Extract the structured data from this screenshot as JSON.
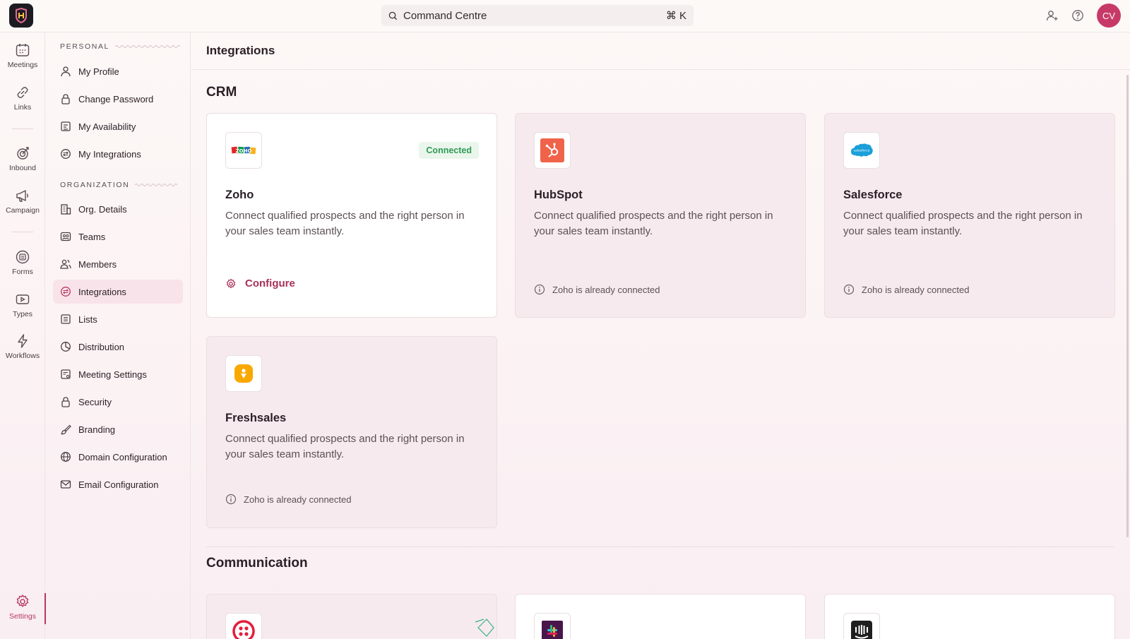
{
  "topbar": {
    "search_label": "Command Centre",
    "shortcut": "⌘ K",
    "avatar_initials": "CV",
    "accent_color": "#c73a68"
  },
  "rail": {
    "items": [
      {
        "label": "Meetings",
        "icon": "calendar-icon"
      },
      {
        "label": "Links",
        "icon": "link-icon"
      },
      {
        "label": "Inbound",
        "icon": "inbound-icon"
      },
      {
        "label": "Campaign",
        "icon": "megaphone-icon"
      },
      {
        "label": "Forms",
        "icon": "forms-icon"
      },
      {
        "label": "Types",
        "icon": "video-icon"
      },
      {
        "label": "Workflows",
        "icon": "lightning-icon"
      },
      {
        "label": "Settings",
        "icon": "gear-icon",
        "active": true
      }
    ]
  },
  "subnav": {
    "personal_heading": "PERSONAL",
    "organization_heading": "ORGANIZATION",
    "personal_items": [
      {
        "label": "My Profile",
        "icon": "user-icon"
      },
      {
        "label": "Change Password",
        "icon": "lock-icon"
      },
      {
        "label": "My Availability",
        "icon": "availability-icon"
      },
      {
        "label": "My Integrations",
        "icon": "integrations-icon"
      }
    ],
    "organization_items": [
      {
        "label": "Org. Details",
        "icon": "building-icon"
      },
      {
        "label": "Teams",
        "icon": "teams-icon"
      },
      {
        "label": "Members",
        "icon": "members-icon"
      },
      {
        "label": "Integrations",
        "icon": "integrations-icon",
        "active": true
      },
      {
        "label": "Lists",
        "icon": "list-icon"
      },
      {
        "label": "Distribution",
        "icon": "pie-icon"
      },
      {
        "label": "Meeting Settings",
        "icon": "meeting-settings-icon"
      },
      {
        "label": "Security",
        "icon": "lock-icon"
      },
      {
        "label": "Branding",
        "icon": "brush-icon"
      },
      {
        "label": "Domain Configuration",
        "icon": "globe-icon"
      },
      {
        "label": "Email Configuration",
        "icon": "mail-icon"
      }
    ]
  },
  "main": {
    "page_title": "Integrations",
    "crm_title": "CRM",
    "communication_title": "Communication",
    "crm_cards": [
      {
        "name": "Zoho",
        "description": "Connect qualified prospects and the right person in your sales team instantly.",
        "status": "Connected",
        "action": "Configure",
        "logo_text": "ZOHO"
      },
      {
        "name": "HubSpot",
        "description": "Connect qualified prospects and the right person in your sales team instantly.",
        "note": "Zoho is already connected"
      },
      {
        "name": "Salesforce",
        "description": "Connect qualified prospects and the right person in your sales team instantly.",
        "note": "Zoho is already connected",
        "logo_text": "salesforce"
      },
      {
        "name": "Freshsales",
        "description": "Connect qualified prospects and the right person in your sales team instantly.",
        "note": "Zoho is already connected"
      }
    ]
  }
}
